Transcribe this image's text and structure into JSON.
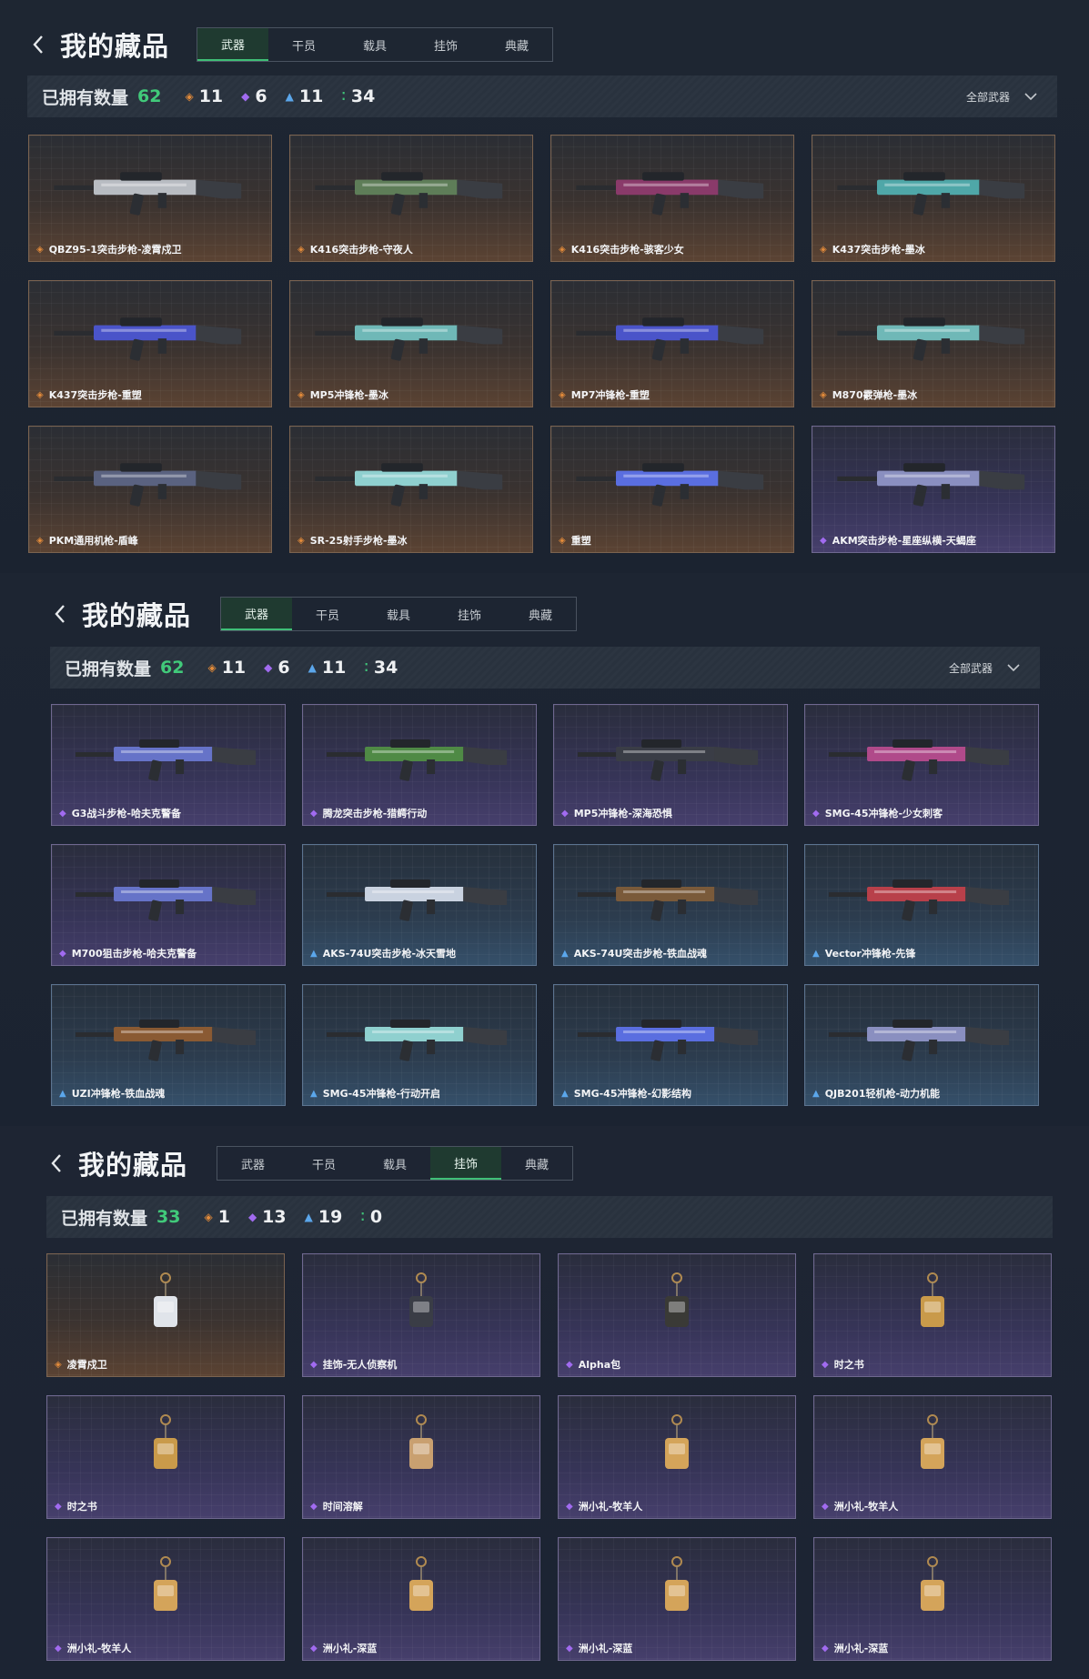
{
  "panels": [
    {
      "title": "我的藏品",
      "tabs": [
        "武器",
        "干员",
        "载具",
        "挂饰",
        "典藏"
      ],
      "active_tab": 0,
      "owned_label": "已拥有数量",
      "owned_count": "62",
      "rarity_counts": [
        {
          "icon": "orange-diamond-icon",
          "value": "11"
        },
        {
          "icon": "purple-diamond-icon",
          "value": "6"
        },
        {
          "icon": "blue-arrow-icon",
          "value": "11"
        },
        {
          "icon": "green-dots-icon",
          "value": "34"
        }
      ],
      "filter_label": "全部武器",
      "items": [
        {
          "name": "QBZ95-1突击步枪-凌霄戍卫",
          "rarity": "orange",
          "color": "#b8bcc2"
        },
        {
          "name": "K416突击步枪-守夜人",
          "rarity": "orange",
          "color": "#5e7d58"
        },
        {
          "name": "K416突击步枪-骇客少女",
          "rarity": "orange",
          "color": "#8a3a6a"
        },
        {
          "name": "K437突击步枪-墨冰",
          "rarity": "orange",
          "color": "#4fa7a8"
        },
        {
          "name": "K437突击步枪-重塑",
          "rarity": "orange",
          "color": "#4a54c9"
        },
        {
          "name": "MP5冲锋枪-墨冰",
          "rarity": "orange",
          "color": "#6fb8b7"
        },
        {
          "name": "MP7冲锋枪-重塑",
          "rarity": "orange",
          "color": "#4a54c9"
        },
        {
          "name": "M870霰弹枪-墨冰",
          "rarity": "orange",
          "color": "#6fb8b7"
        },
        {
          "name": "PKM通用机枪-盾峰",
          "rarity": "orange",
          "color": "#5a6280"
        },
        {
          "name": "SR-25射手步枪-墨冰",
          "rarity": "orange",
          "color": "#8fd0cf"
        },
        {
          "name": "重塑",
          "rarity": "orange",
          "color": "#5a6ee0"
        },
        {
          "name": "AKM突击步枪-星座纵横-天蝎座",
          "rarity": "purple",
          "color": "#8a8fc0"
        }
      ]
    },
    {
      "title": "我的藏品",
      "tabs": [
        "武器",
        "干员",
        "载具",
        "挂饰",
        "典藏"
      ],
      "active_tab": 0,
      "owned_label": "已拥有数量",
      "owned_count": "62",
      "rarity_counts": [
        {
          "icon": "orange-diamond-icon",
          "value": "11"
        },
        {
          "icon": "purple-diamond-icon",
          "value": "6"
        },
        {
          "icon": "blue-arrow-icon",
          "value": "11"
        },
        {
          "icon": "green-dots-icon",
          "value": "34"
        }
      ],
      "filter_label": "全部武器",
      "items": [
        {
          "name": "G3战斗步枪-哈夫克警备",
          "rarity": "purple",
          "color": "#6673c8"
        },
        {
          "name": "腾龙突击步枪-猎鳄行动",
          "rarity": "purple",
          "color": "#4f8a45"
        },
        {
          "name": "MP5冲锋枪-深海恐惧",
          "rarity": "purple",
          "color": "#3a3d46"
        },
        {
          "name": "SMG-45冲锋枪-少女刺客",
          "rarity": "purple",
          "color": "#b04a8a"
        },
        {
          "name": "M700狙击步枪-哈夫克警备",
          "rarity": "purple",
          "color": "#6673c8"
        },
        {
          "name": "AKS-74U突击步枪-冰天雪地",
          "rarity": "blue",
          "color": "#c9d2e0"
        },
        {
          "name": "AKS-74U突击步枪-铁血战魂",
          "rarity": "blue",
          "color": "#7a5a3a"
        },
        {
          "name": "Vector冲锋枪-先锋",
          "rarity": "blue",
          "color": "#b8404a"
        },
        {
          "name": "UZI冲锋枪-铁血战魂",
          "rarity": "blue",
          "color": "#8a5a33"
        },
        {
          "name": "SMG-45冲锋枪-行动开启",
          "rarity": "blue",
          "color": "#8fd0cf"
        },
        {
          "name": "SMG-45冲锋枪-幻影结构",
          "rarity": "blue",
          "color": "#5a6ee0"
        },
        {
          "name": "QJB201轻机枪-动力机能",
          "rarity": "blue",
          "color": "#8a8fc0"
        }
      ]
    },
    {
      "title": "我的藏品",
      "tabs": [
        "武器",
        "干员",
        "载具",
        "挂饰",
        "典藏"
      ],
      "active_tab": 3,
      "owned_label": "已拥有数量",
      "owned_count": "33",
      "rarity_counts": [
        {
          "icon": "orange-diamond-icon",
          "value": "1"
        },
        {
          "icon": "purple-diamond-icon",
          "value": "13"
        },
        {
          "icon": "blue-arrow-icon",
          "value": "19"
        },
        {
          "icon": "green-dots-icon",
          "value": "0"
        }
      ],
      "filter_label": "",
      "items": [
        {
          "name": "凌霄戍卫",
          "rarity": "orange",
          "color": "#e0e4ea"
        },
        {
          "name": "挂饰-无人侦察机",
          "rarity": "purple",
          "color": "#3a3d46"
        },
        {
          "name": "Alpha包",
          "rarity": "purple",
          "color": "#3a3a36"
        },
        {
          "name": "时之书",
          "rarity": "purple",
          "color": "#c99a4a"
        },
        {
          "name": "时之书",
          "rarity": "purple",
          "color": "#c99a4a"
        },
        {
          "name": "时间溶解",
          "rarity": "purple",
          "color": "#c9a070"
        },
        {
          "name": "洲小礼-牧羊人",
          "rarity": "purple",
          "color": "#d4a45a"
        },
        {
          "name": "洲小礼-牧羊人",
          "rarity": "purple",
          "color": "#d4a45a"
        },
        {
          "name": "洲小礼-牧羊人",
          "rarity": "purple",
          "color": "#d4a45a"
        },
        {
          "name": "洲小礼-深蓝",
          "rarity": "purple",
          "color": "#d4a45a"
        },
        {
          "name": "洲小礼-深蓝",
          "rarity": "purple",
          "color": "#d4a45a"
        },
        {
          "name": "洲小礼-深蓝",
          "rarity": "purple",
          "color": "#d4a45a"
        }
      ]
    }
  ]
}
